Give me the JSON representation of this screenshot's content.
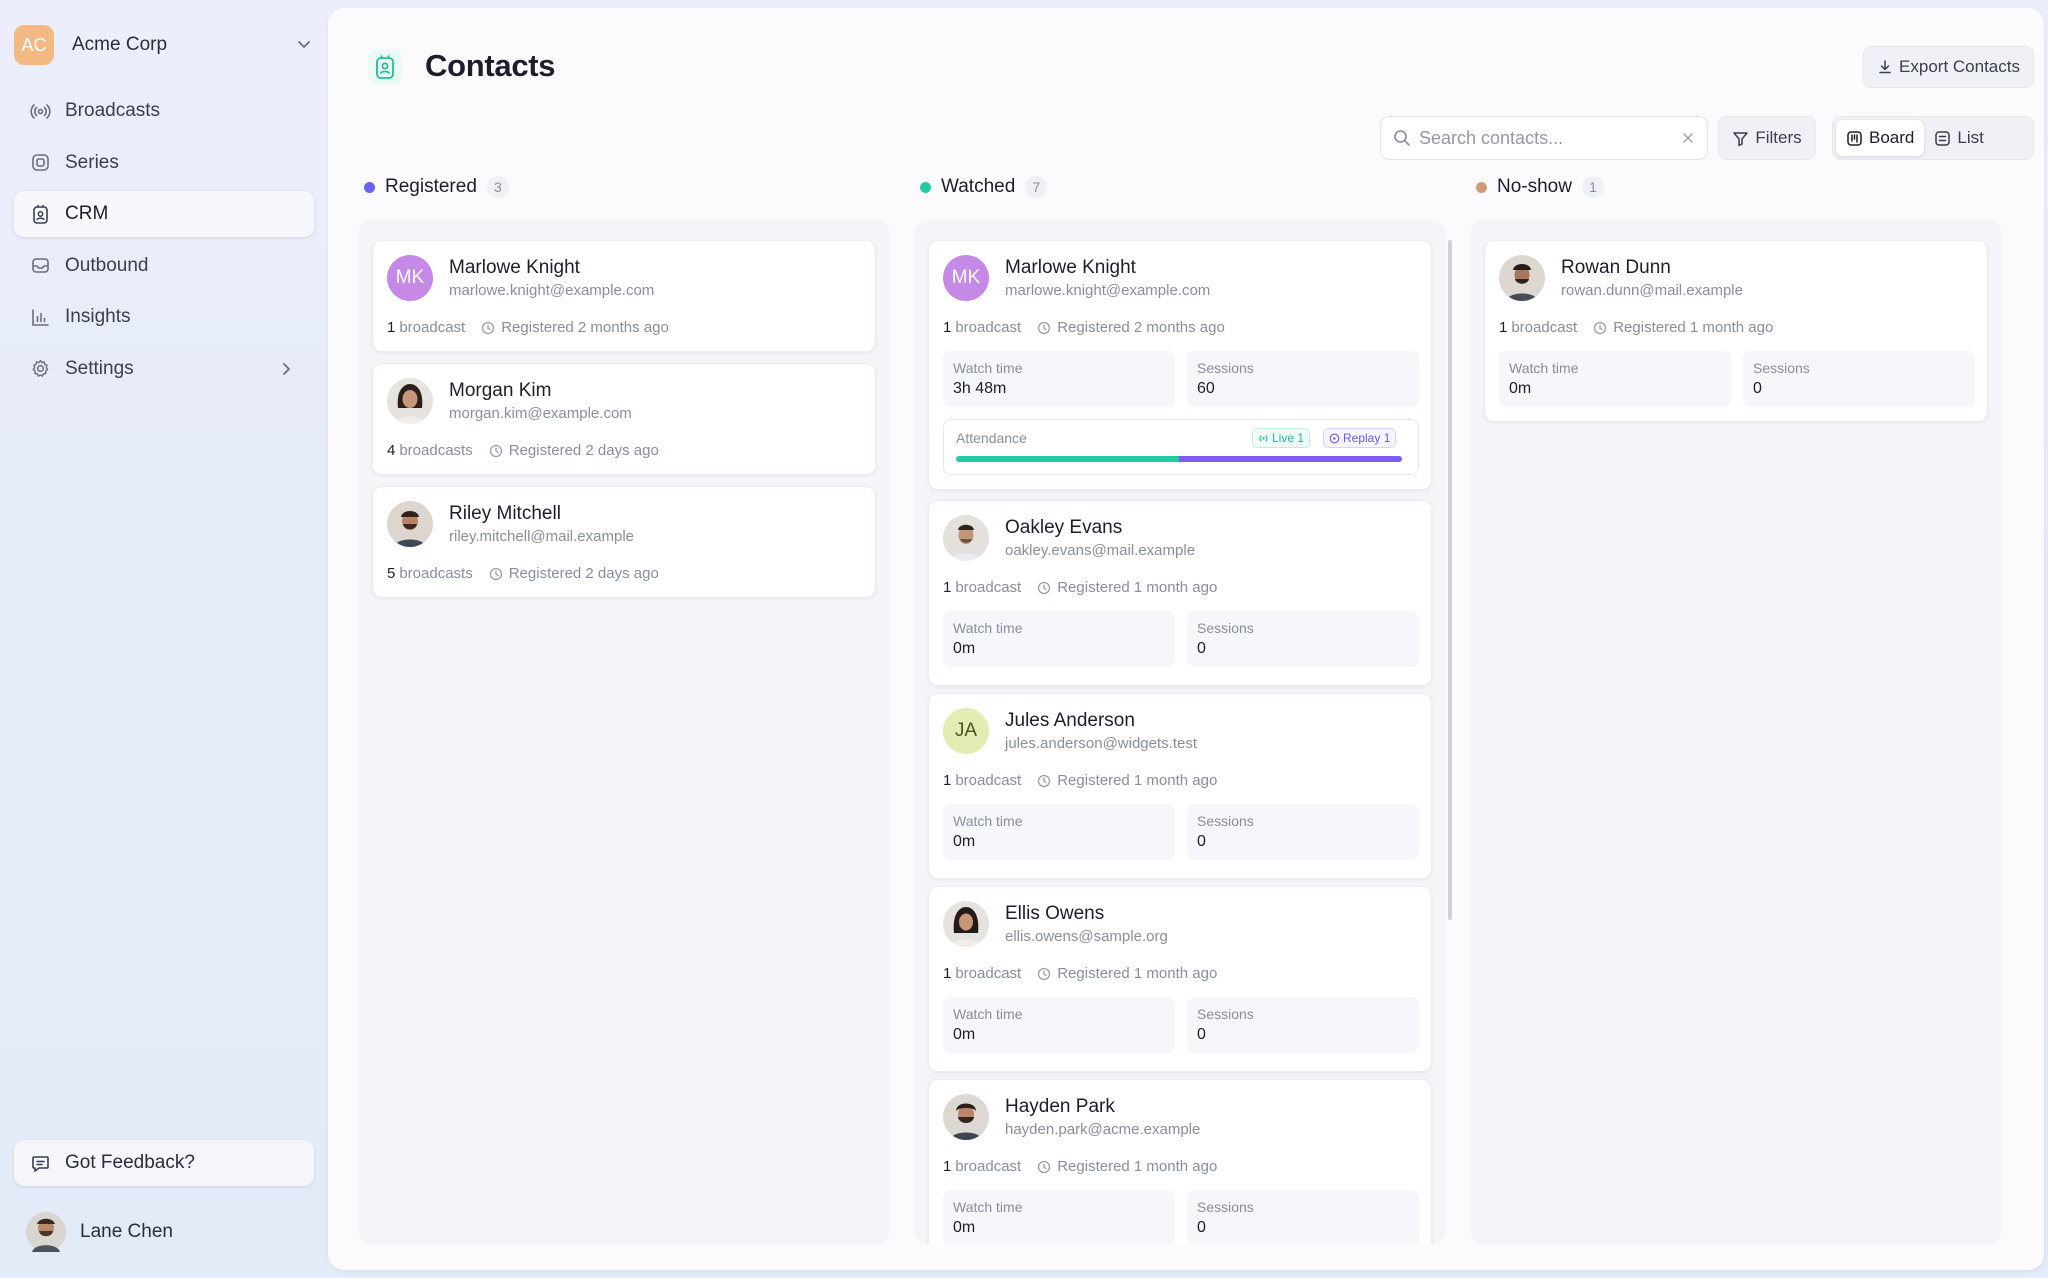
{
  "org": {
    "initials": "AC",
    "name": "Acme Corp"
  },
  "nav": [
    {
      "label": "Broadcasts",
      "icon": "broadcast-icon"
    },
    {
      "label": "Series",
      "icon": "series-icon"
    },
    {
      "label": "CRM",
      "icon": "crm-icon",
      "active": true
    },
    {
      "label": "Outbound",
      "icon": "inbox-icon"
    },
    {
      "label": "Insights",
      "icon": "bar-chart-icon"
    },
    {
      "label": "Settings",
      "icon": "gear-icon"
    }
  ],
  "feedback": {
    "label": "Got Feedback?"
  },
  "user": {
    "name": "Lane Chen"
  },
  "page": {
    "title": "Contacts",
    "export_label": "Export Contacts"
  },
  "toolbar": {
    "search_placeholder": "Search contacts...",
    "filters_label": "Filters",
    "view_options": [
      "Board",
      "List"
    ],
    "selected_view": "Board"
  },
  "columns": [
    {
      "title": "Registered",
      "count": "3",
      "color": "#6a63f6",
      "cards": [
        {
          "name": "Marlowe Knight",
          "email": "marlowe.knight@example.com",
          "initials": "MK",
          "avatar_color": "#c48ae6",
          "broadcasts_count": "1",
          "broadcasts_word": "broadcast",
          "registered": "Registered 2 months ago"
        },
        {
          "name": "Morgan Kim",
          "email": "morgan.kim@example.com",
          "initials": "",
          "avatar_color": "#5a4a44",
          "broadcasts_count": "4",
          "broadcasts_word": "broadcasts",
          "registered": "Registered 2 days ago"
        },
        {
          "name": "Riley Mitchell",
          "email": "riley.mitchell@mail.example",
          "initials": "",
          "avatar_color": "#6b5a4e",
          "broadcasts_count": "5",
          "broadcasts_word": "broadcasts",
          "registered": "Registered 2 days ago"
        }
      ]
    },
    {
      "title": "Watched",
      "count": "7",
      "color": "#27c9a2",
      "cards": [
        {
          "name": "Marlowe Knight",
          "email": "marlowe.knight@example.com",
          "initials": "MK",
          "avatar_color": "#c48ae6",
          "broadcasts_count": "1",
          "broadcasts_word": "broadcast",
          "registered": "Registered 2 months ago",
          "watch_label": "Watch time",
          "watch_time": "3h 48m",
          "sessions_label": "Sessions",
          "sessions": "60",
          "attendance": {
            "label": "Attendance",
            "live_label": "Live 1",
            "replay_label": "Replay 1",
            "live_fraction": 0.5,
            "replay_fraction": 0.5
          }
        },
        {
          "name": "Oakley Evans",
          "email": "oakley.evans@mail.example",
          "initials": "",
          "avatar_color": "#7b6a5e",
          "broadcasts_count": "1",
          "broadcasts_word": "broadcast",
          "registered": "Registered 1 month ago",
          "watch_label": "Watch time",
          "watch_time": "0m",
          "sessions_label": "Sessions",
          "sessions": "0"
        },
        {
          "name": "Jules Anderson",
          "email": "jules.anderson@widgets.test",
          "initials": "JA",
          "avatar_color": "#e3ecb2",
          "broadcasts_count": "1",
          "broadcasts_word": "broadcast",
          "registered": "Registered 1 month ago",
          "watch_label": "Watch time",
          "watch_time": "0m",
          "sessions_label": "Sessions",
          "sessions": "0"
        },
        {
          "name": "Ellis Owens",
          "email": "ellis.owens@sample.org",
          "initials": "",
          "avatar_color": "#4b3a36",
          "broadcasts_count": "1",
          "broadcasts_word": "broadcast",
          "registered": "Registered 1 month ago",
          "watch_label": "Watch time",
          "watch_time": "0m",
          "sessions_label": "Sessions",
          "sessions": "0"
        },
        {
          "name": "Hayden Park",
          "email": "hayden.park@acme.example",
          "initials": "",
          "avatar_color": "#5e4e46",
          "broadcasts_count": "1",
          "broadcasts_word": "broadcast",
          "registered": "Registered 1 month ago",
          "watch_label": "Watch time",
          "watch_time": "0m",
          "sessions_label": "Sessions",
          "sessions": "0"
        }
      ]
    },
    {
      "title": "No-show",
      "count": "1",
      "color": "#d39a76",
      "cards": [
        {
          "name": "Rowan Dunn",
          "email": "rowan.dunn@mail.example",
          "initials": "",
          "avatar_color": "#5a4a40",
          "broadcasts_count": "1",
          "broadcasts_word": "broadcast",
          "registered": "Registered 1 month ago",
          "watch_label": "Watch time",
          "watch_time": "0m",
          "sessions_label": "Sessions",
          "sessions": "0"
        }
      ]
    }
  ]
}
